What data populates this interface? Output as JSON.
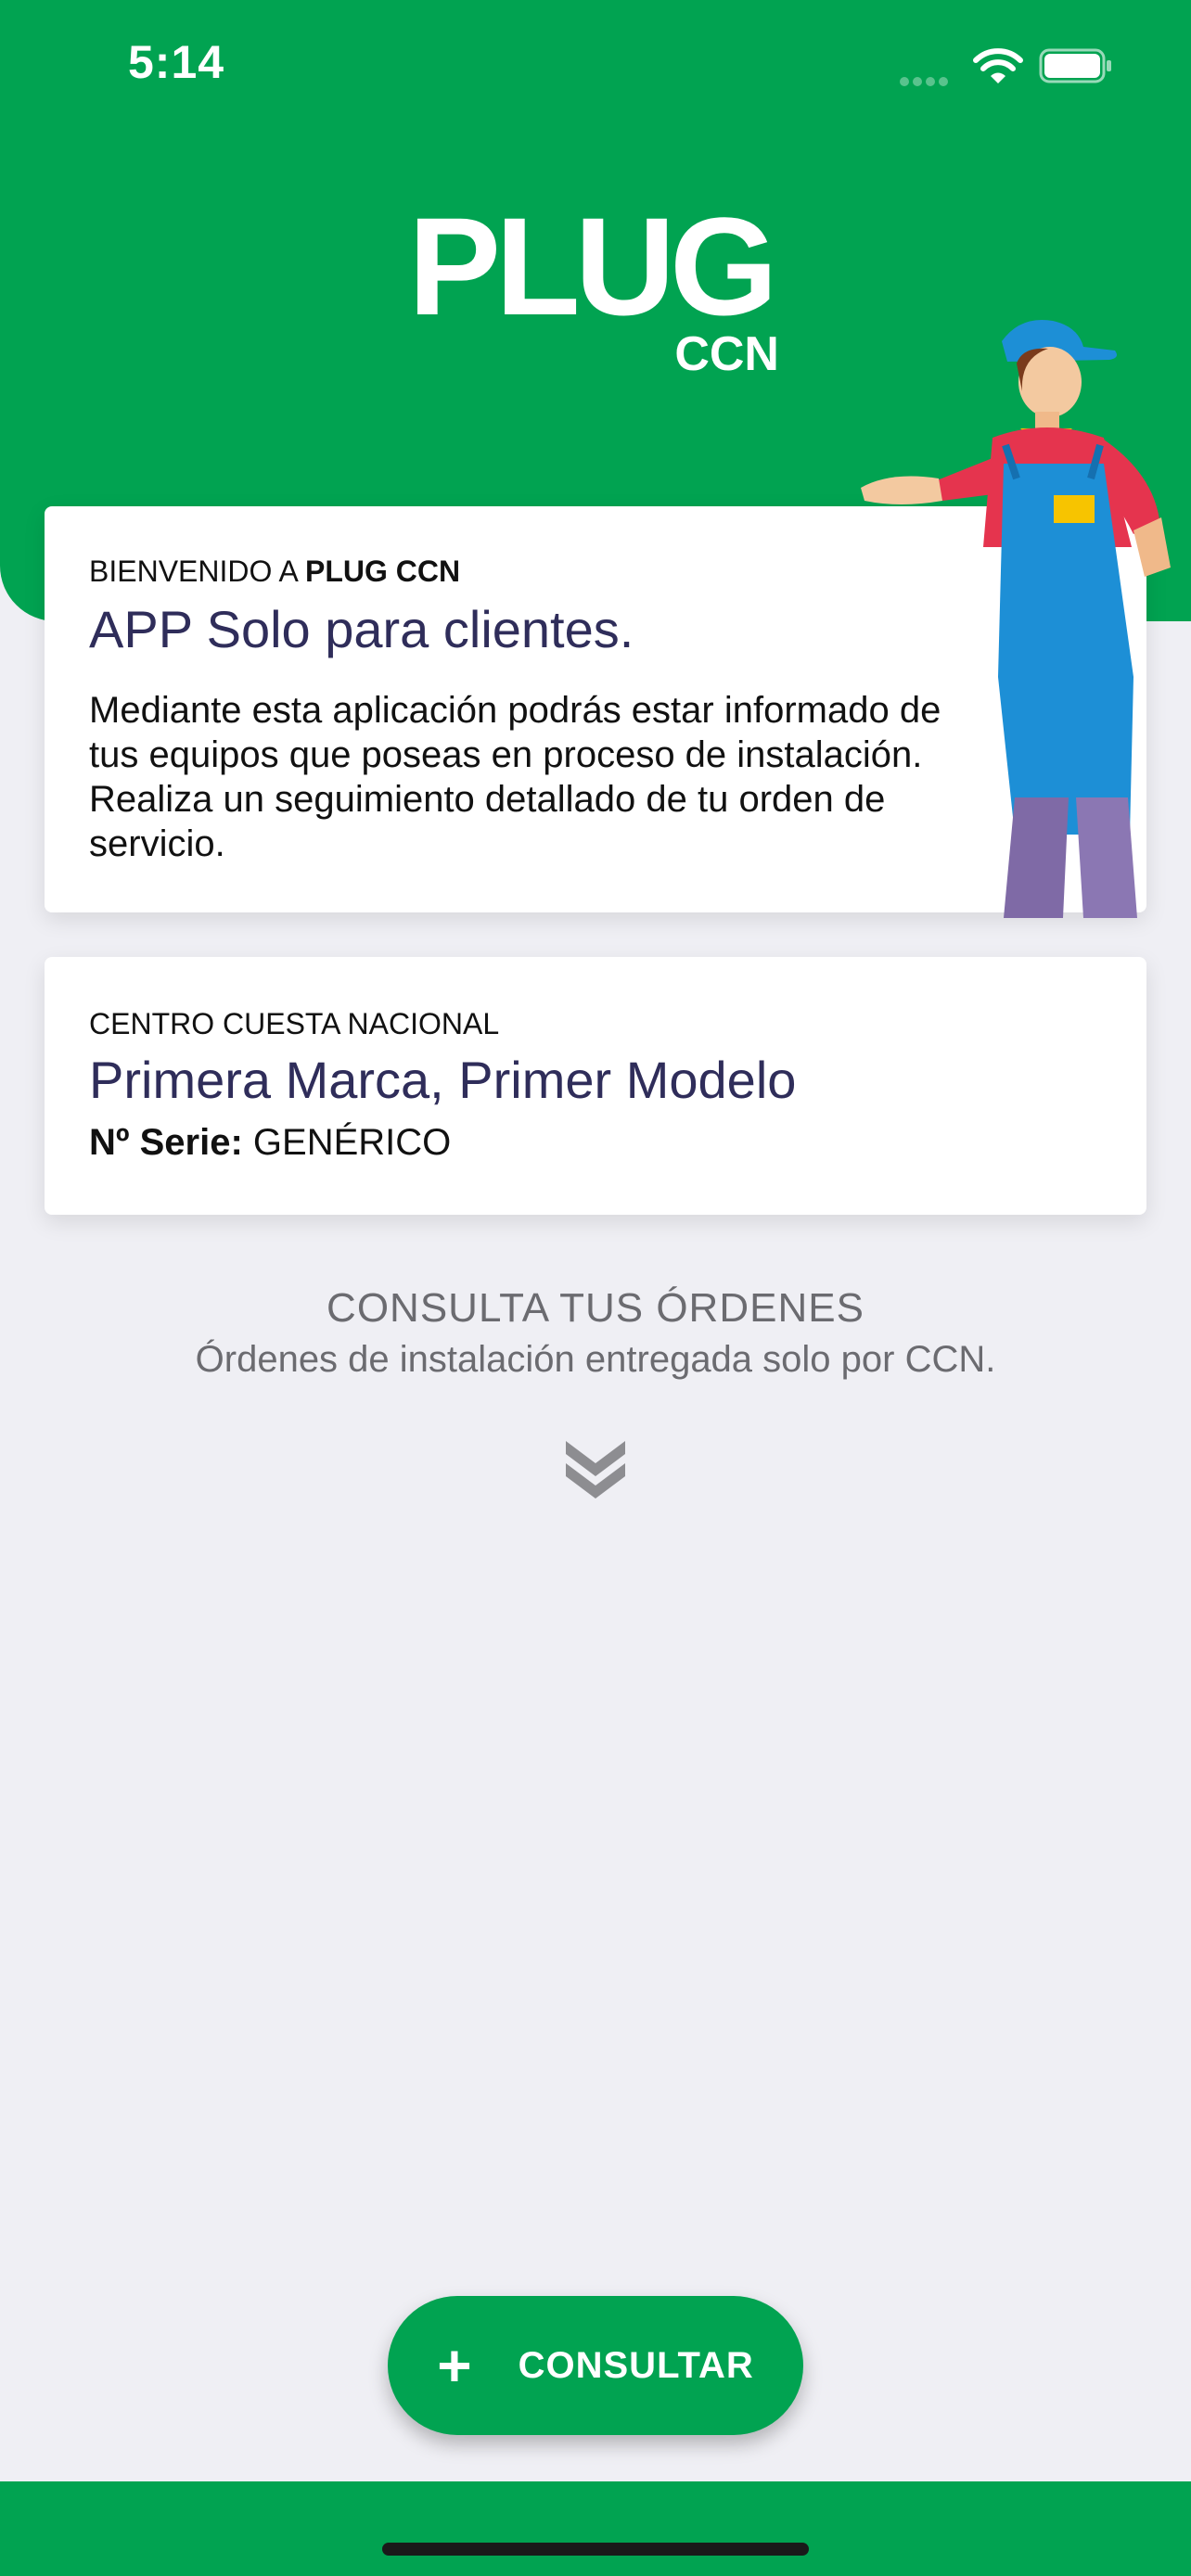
{
  "status_bar": {
    "time": "5:14"
  },
  "logo": {
    "word": "PLUG",
    "sub": "CCN"
  },
  "welcome_card": {
    "prefix": "BIENVENIDO A ",
    "brand": "PLUG CCN",
    "title": "APP Solo para clientes.",
    "description": "Mediante esta aplicación podrás estar informado de tus equipos que poseas en proceso de instalación. Realiza un seguimiento detallado de tu orden de servicio."
  },
  "equipment_card": {
    "center": "CENTRO CUESTA NACIONAL",
    "product": "Primera Marca, Primer Modelo",
    "serial_label": "Nº Serie:",
    "serial_value": " GENÉRICO"
  },
  "consult": {
    "title": "CONSULTA TUS ÓRDENES",
    "subtitle": "Órdenes de instalación entregada solo por CCN."
  },
  "fab": {
    "icon": "+",
    "label": "CONSULTAR"
  },
  "colors": {
    "brand_green": "#01a351",
    "title_navy": "#2f2d5a",
    "background": "#efeff4"
  }
}
